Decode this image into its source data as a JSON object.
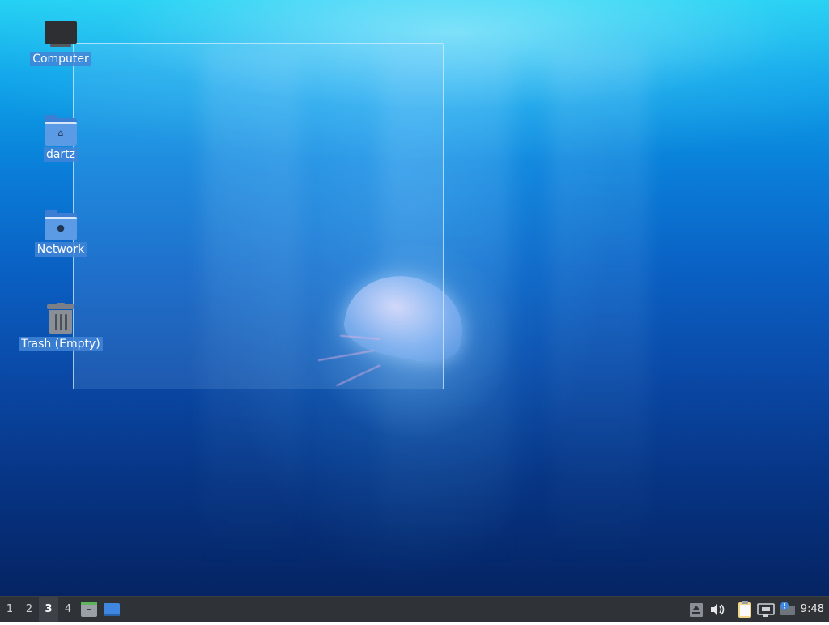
{
  "desktop": {
    "icons": [
      {
        "label": "Computer",
        "icon": "computer-icon"
      },
      {
        "label": "dartz",
        "icon": "home-folder-icon"
      },
      {
        "label": "Network",
        "icon": "network-folder-icon"
      },
      {
        "label": "Trash (Empty)",
        "icon": "trash-icon"
      }
    ]
  },
  "panel": {
    "workspaces": [
      "1",
      "2",
      "3",
      "4"
    ],
    "active_workspace": "3",
    "launchers": [
      "file-manager-icon",
      "show-desktop-icon"
    ],
    "tray": [
      "eject-icon",
      "volume-icon",
      "clipboard-icon",
      "network-wired-icon",
      "notification-icon"
    ],
    "clock": "9:48"
  },
  "colors": {
    "panel_bg": "#2f3236",
    "icon_label_bg": "#4285d7",
    "folder": "#5b9ae4"
  }
}
